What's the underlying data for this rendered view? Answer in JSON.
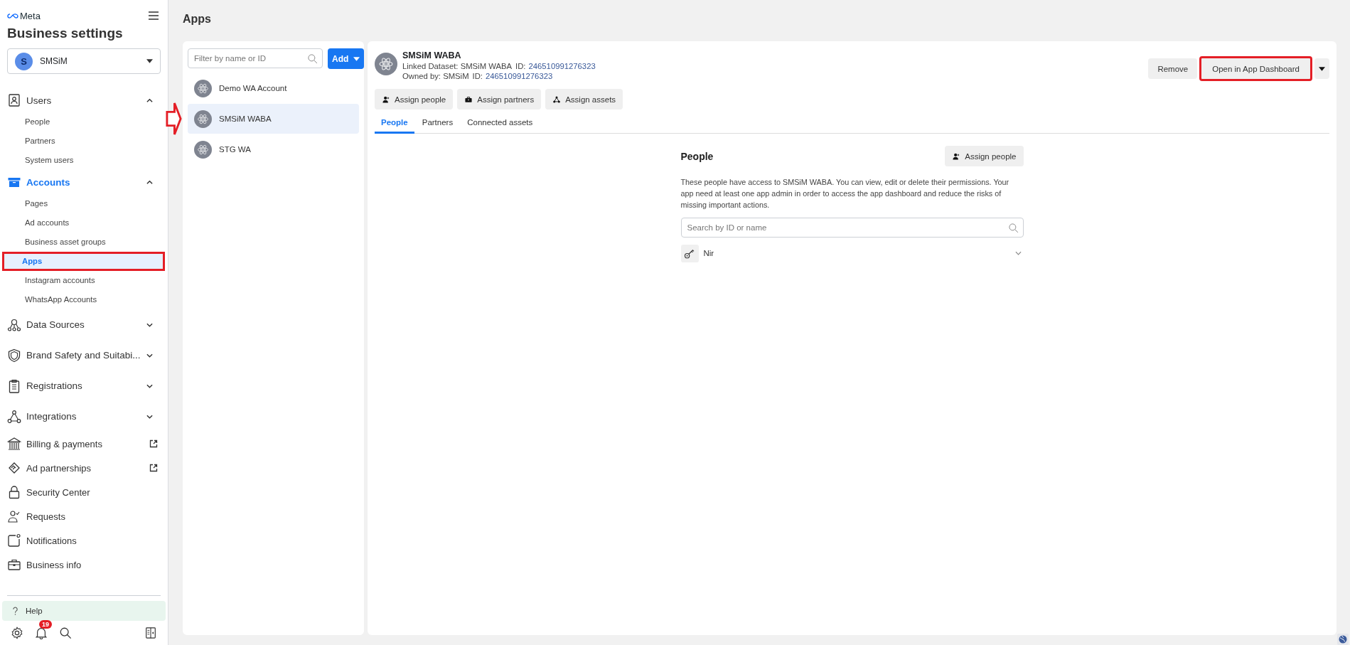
{
  "sidebar": {
    "brand": "Meta",
    "title": "Business settings",
    "business": {
      "initial": "S",
      "name": "SMSiM"
    },
    "items": [
      {
        "kind": "group",
        "label": "Users",
        "expanded": true,
        "selected": false,
        "children": [
          {
            "label": "People",
            "selected": false,
            "annotated": false
          },
          {
            "label": "Partners",
            "selected": false,
            "annotated": false
          },
          {
            "label": "System users",
            "selected": false,
            "annotated": false
          }
        ]
      },
      {
        "kind": "group",
        "label": "Accounts",
        "expanded": true,
        "selected": true,
        "children": [
          {
            "label": "Pages",
            "selected": false,
            "annotated": false
          },
          {
            "label": "Ad accounts",
            "selected": false,
            "annotated": false
          },
          {
            "label": "Business asset groups",
            "selected": false,
            "annotated": false
          },
          {
            "label": "Apps",
            "selected": true,
            "annotated": true
          },
          {
            "label": "Instagram accounts",
            "selected": false,
            "annotated": false
          },
          {
            "label": "WhatsApp Accounts",
            "selected": false,
            "annotated": false
          }
        ]
      },
      {
        "kind": "group",
        "label": "Data Sources",
        "expanded": false,
        "selected": false
      },
      {
        "kind": "group",
        "label": "Brand Safety and Suitabi...",
        "expanded": false,
        "selected": false
      },
      {
        "kind": "group",
        "label": "Registrations",
        "expanded": false,
        "selected": false
      },
      {
        "kind": "group",
        "label": "Integrations",
        "expanded": false,
        "selected": false
      },
      {
        "kind": "link",
        "label": "Billing & payments",
        "external": true
      },
      {
        "kind": "link",
        "label": "Ad partnerships",
        "external": true
      },
      {
        "kind": "link",
        "label": "Security Center",
        "external": false
      },
      {
        "kind": "link",
        "label": "Requests",
        "external": false
      },
      {
        "kind": "link",
        "label": "Notifications",
        "external": false
      },
      {
        "kind": "link",
        "label": "Business info",
        "external": false
      }
    ],
    "help": "Help",
    "notification_count": "19"
  },
  "page_title": "Apps",
  "apps_list": {
    "filter_placeholder": "Filter by name or ID",
    "add_button": "Add",
    "items": [
      {
        "name": "Demo WA Account",
        "selected": false,
        "annotated": false
      },
      {
        "name": "SMSiM WABA",
        "selected": true,
        "annotated": true
      },
      {
        "name": "STG WA",
        "selected": false,
        "annotated": false
      }
    ]
  },
  "detail": {
    "name": "SMSiM WABA",
    "info_lines": [
      {
        "text": "Linked Dataset: SMSiM WABA",
        "id_prefix": "ID:",
        "id": "246510991276323"
      },
      {
        "text": "Owned by: SMSiM",
        "id_prefix": "ID:",
        "id": "246510991276323"
      }
    ],
    "remove_button": "Remove",
    "open_button": {
      "label": "Open in App Dashboard",
      "annotated": true
    },
    "actions": [
      "Assign people",
      "Assign partners",
      "Assign assets"
    ],
    "tabs": [
      {
        "label": "People",
        "selected": true
      },
      {
        "label": "Partners",
        "selected": false
      },
      {
        "label": "Connected assets",
        "selected": false
      }
    ],
    "people": {
      "title": "People",
      "assign_button": "Assign people",
      "description": "These people have access to SMSiM WABA. You can view, edit or delete their permissions. Your app need at least one app admin in order to access the app dashboard and reduce the risks of missing important actions.",
      "search_placeholder": "Search by ID or name",
      "members": [
        {
          "name": "Nir",
          "expanded": false
        }
      ]
    }
  }
}
